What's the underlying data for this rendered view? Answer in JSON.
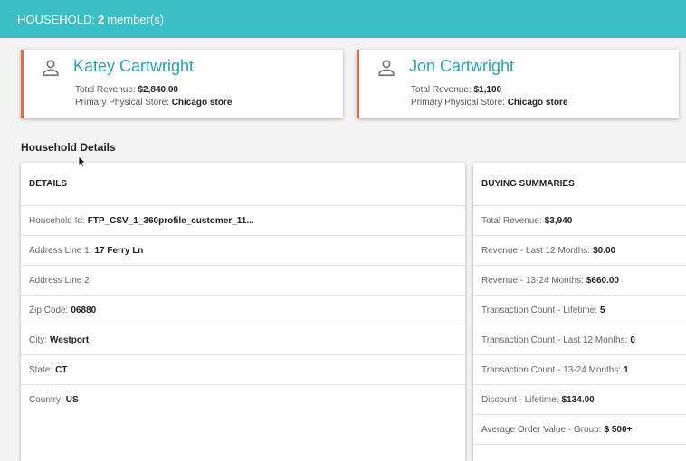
{
  "header": {
    "label": "HOUSEHOLD:",
    "count": "2",
    "suffix": "member(s)"
  },
  "members": [
    {
      "name": "Katey Cartwright",
      "revenue_label": "Total Revenue:",
      "revenue_value": "$2,840.00",
      "store_label": "Primary Physical Store:",
      "store_value": "Chicago store"
    },
    {
      "name": "Jon Cartwright",
      "revenue_label": "Total Revenue:",
      "revenue_value": "$1,100",
      "store_label": "Primary Physical Store:",
      "store_value": "Chicago store"
    }
  ],
  "household_details_title": "Household Details",
  "details": {
    "title": "DETAILS",
    "rows": [
      {
        "label": "Household Id:",
        "value": "FTP_CSV_1_360profile_customer_11..."
      },
      {
        "label": "Address Line 1:",
        "value": "17 Ferry Ln"
      },
      {
        "label": "Address Line 2",
        "value": ""
      },
      {
        "label": "Zip Code:",
        "value": "06880"
      },
      {
        "label": "City:",
        "value": "Westport"
      },
      {
        "label": "State:",
        "value": "CT"
      },
      {
        "label": "Country:",
        "value": "US"
      }
    ]
  },
  "buying_summaries": {
    "title": "BUYING SUMMARIES",
    "rows": [
      {
        "label": "Total Revenue:",
        "value": "$3,940"
      },
      {
        "label": "Revenue - Last 12 Months:",
        "value": "$0.00"
      },
      {
        "label": "Revenue - 13-24 Months:",
        "value": "$660.00"
      },
      {
        "label": "Transaction Count - Lifetime:",
        "value": "5"
      },
      {
        "label": "Transaction Count - Last 12 Months:",
        "value": "0"
      },
      {
        "label": "Transaction Count - 13-24 Months:",
        "value": "1"
      },
      {
        "label": "Discount - Lifetime:",
        "value": "$134.00"
      },
      {
        "label": "Average Order Value - Group:",
        "value": "$ 500+"
      }
    ]
  },
  "colors": {
    "topbar": "#3bbfc7",
    "name": "#2aa3ad",
    "card_accent": "#e06a4d"
  },
  "icons": {
    "member": "person-icon"
  }
}
